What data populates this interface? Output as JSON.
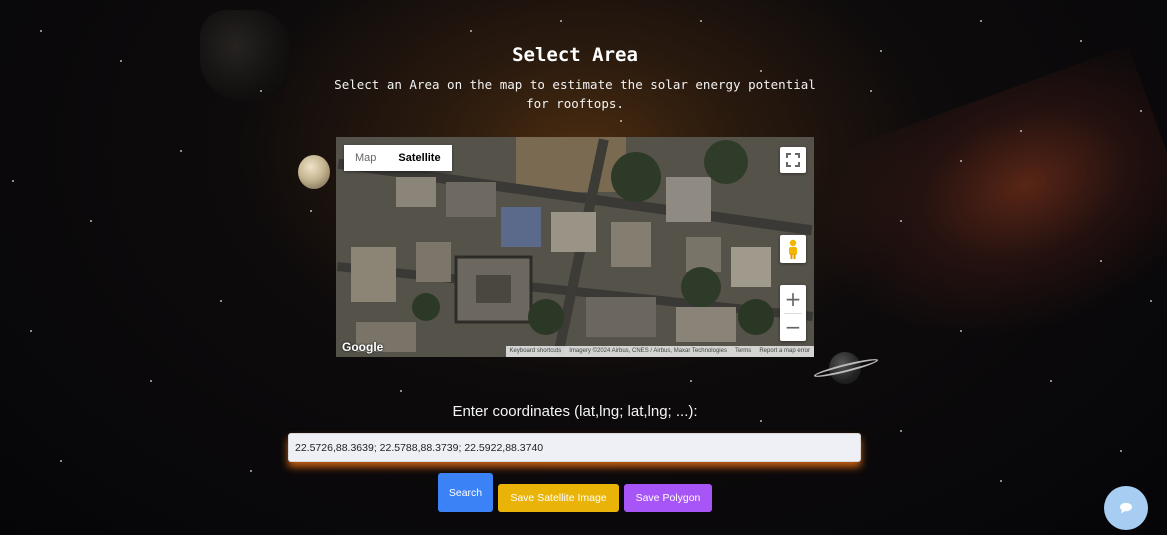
{
  "header": {
    "title": "Select Area",
    "subtitle": "Select an Area on the map to estimate the solar energy potential for rooftops."
  },
  "map": {
    "type_map_label": "Map",
    "type_satellite_label": "Satellite",
    "active_type": "Satellite",
    "logo": "Google",
    "attribution": {
      "shortcuts": "Keyboard shortcuts",
      "imagery": "Imagery ©2024 Airbus, CNES / Airbus, Maxar Technologies",
      "terms": "Terms",
      "report": "Report a map error"
    },
    "icons": {
      "fullscreen": "fullscreen-icon",
      "pegman": "pegman-icon",
      "zoom_in": "plus-icon",
      "zoom_out": "minus-icon"
    }
  },
  "coordinates": {
    "label": "Enter coordinates (lat,lng; lat,lng; ...):",
    "value": "22.5726,88.3639; 22.5788,88.3739; 22.5922,88.3740"
  },
  "buttons": {
    "search": "Search",
    "save_image": "Save Satellite Image",
    "save_polygon": "Save Polygon"
  },
  "colors": {
    "search": "#3b82f6",
    "save_image": "#eab308",
    "save_polygon": "#a855f7",
    "chat": "#a7cdf2",
    "input_glow": "#e66e14"
  },
  "chat_widget": {
    "icon": "chat-bubble-icon"
  }
}
